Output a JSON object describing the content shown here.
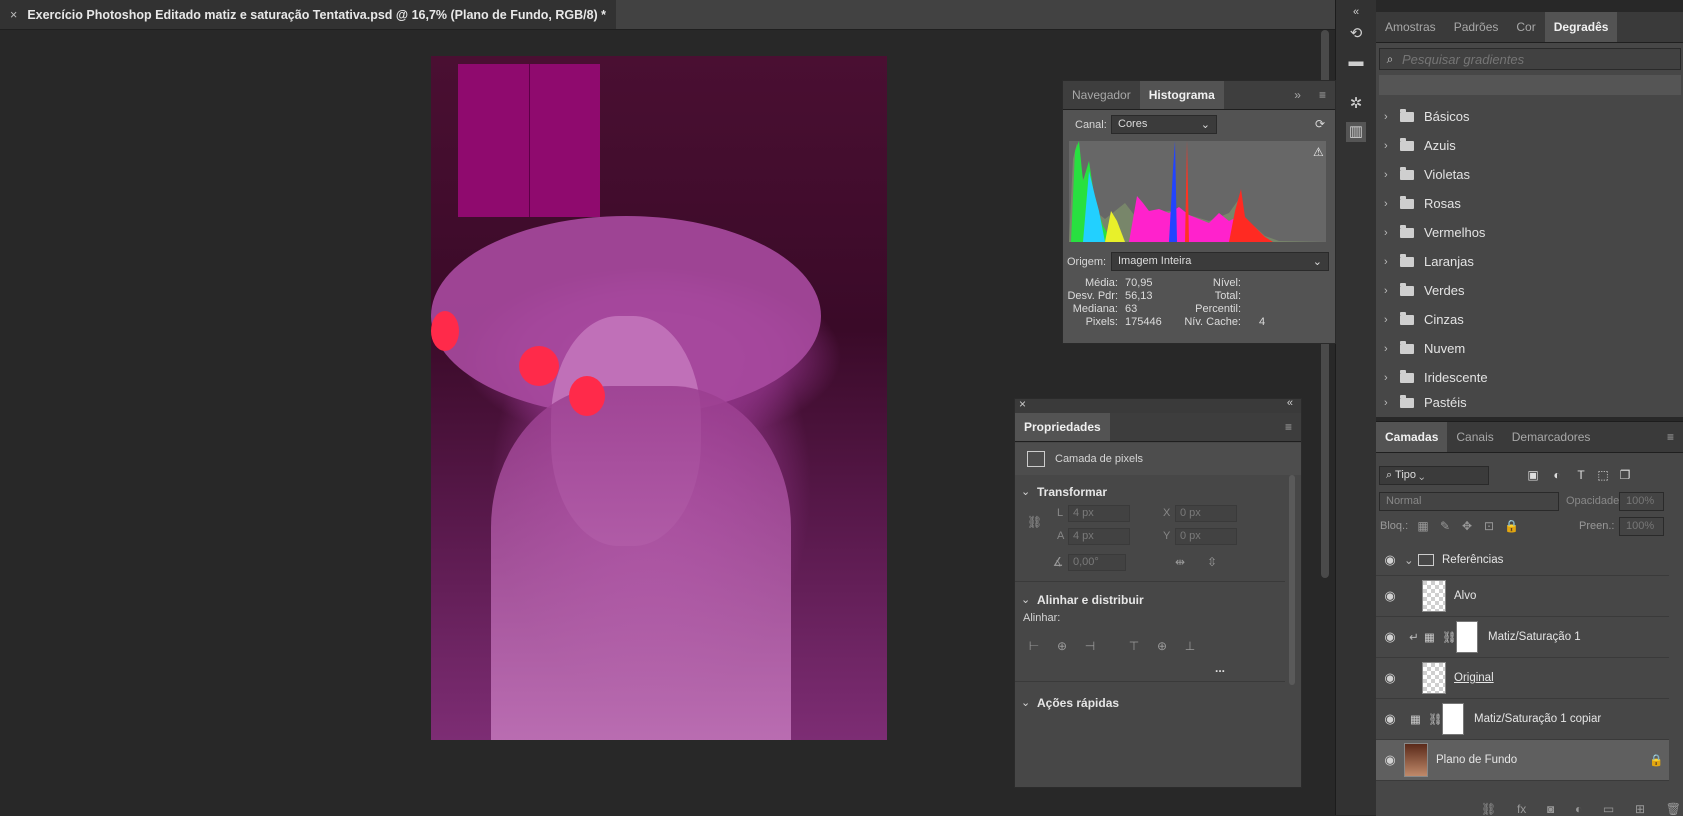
{
  "document": {
    "tab_title": "Exercício Photoshop Editado matiz e saturação Tentativa.psd @ 16,7% (Plano de Fundo, RGB/8) *",
    "close_glyph": "×"
  },
  "gradients_panel": {
    "tabs": [
      "Amostras",
      "Padrões",
      "Cor",
      "Degradês"
    ],
    "active_tab": "Degradês",
    "search_placeholder": "Pesquisar gradientes",
    "folders": [
      "Básicos",
      "Azuis",
      "Violetas",
      "Rosas",
      "Vermelhos",
      "Laranjas",
      "Verdes",
      "Cinzas",
      "Nuvem",
      "Iridescente",
      "Pastéis"
    ]
  },
  "histogram_panel": {
    "tabs": [
      "Navegador",
      "Histograma"
    ],
    "active_tab": "Histograma",
    "channel_label": "Canal:",
    "channel_value": "Cores",
    "source_label": "Origem:",
    "source_value": "Imagem Inteira",
    "stats_left": [
      {
        "label": "Média:",
        "value": "70,95"
      },
      {
        "label": "Desv. Pdr:",
        "value": "56,13"
      },
      {
        "label": "Mediana:",
        "value": "63"
      },
      {
        "label": "Pixels:",
        "value": "175446"
      }
    ],
    "stats_right": [
      {
        "label": "Nível:",
        "value": ""
      },
      {
        "label": "Total:",
        "value": ""
      },
      {
        "label": "Percentil:",
        "value": ""
      },
      {
        "label": "Nív. Cache:",
        "value": "4"
      }
    ]
  },
  "properties_panel": {
    "title": "Propriedades",
    "layer_kind": "Camada de pixels",
    "transform_title": "Transformar",
    "w_label": "L",
    "w_value": "4 px",
    "h_label": "A",
    "h_value": "4 px",
    "x_label": "X",
    "x_value": "0 px",
    "y_label": "Y",
    "y_value": "0 px",
    "angle_value": "0,00°",
    "align_title": "Alinhar e distribuir",
    "align_label": "Alinhar:",
    "more_glyph": "...",
    "quick_actions_title": "Ações rápidas"
  },
  "layers_panel": {
    "tabs": [
      "Camadas",
      "Canais",
      "Demarcadores"
    ],
    "active_tab": "Camadas",
    "filter_value": "Tipo",
    "blend_mode": "Normal",
    "opacity_label": "Opacidade:",
    "opacity_value": "100%",
    "lock_label": "Bloq.:",
    "fill_label": "Preen.:",
    "fill_value": "100%",
    "layers": [
      {
        "name": "Referências",
        "kind": "group"
      },
      {
        "name": "Alvo",
        "kind": "pixel"
      },
      {
        "name": "Matiz/Saturação 1",
        "kind": "adjustment"
      },
      {
        "name": "Original",
        "kind": "pixel"
      },
      {
        "name": "Matiz/Saturação 1 copiar",
        "kind": "adjustment"
      },
      {
        "name": "Plano de Fundo",
        "kind": "background"
      }
    ],
    "footer_icons": [
      "link-icon",
      "fx-icon",
      "mask-icon",
      "adjustment-icon",
      "folder-icon",
      "new-layer-icon",
      "trash-icon"
    ]
  },
  "colors": {
    "app_bg": "#282828",
    "panel_bg": "#474747",
    "tab_active": "#535353",
    "ref_block": "#8f0a6e"
  }
}
